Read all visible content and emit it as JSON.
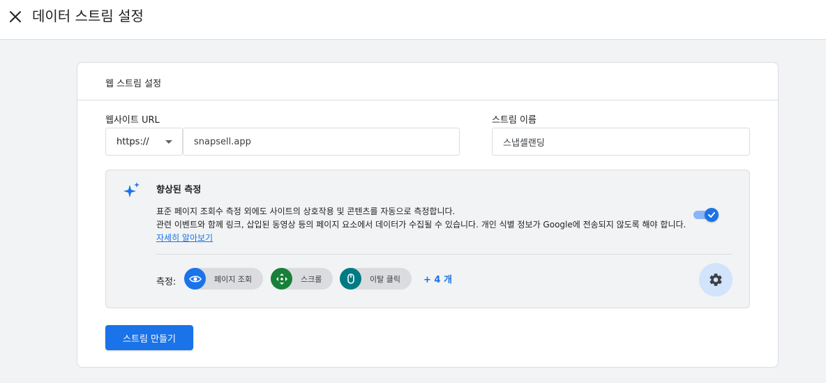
{
  "header": {
    "title": "데이터 스트림 설정",
    "close_icon": "close-icon"
  },
  "card": {
    "title": "웹 스트림 설정"
  },
  "website": {
    "label": "웹사이트 URL",
    "protocol": "https://",
    "url": "snapsell.app"
  },
  "stream_name": {
    "label": "스트림 이름",
    "value": "스냅셀랜딩"
  },
  "enhanced": {
    "icon": "sparkle-icon",
    "title": "향상된 측정",
    "desc_line1": "표준 페이지 조회수 측정 외에도 사이트의 상호작용 및 콘텐츠를 자동으로 측정합니다.",
    "desc_line2": "관련 이벤트와 함께 링크, 삽입된 동영상 등의 페이지 요소에서 데이터가 수집될 수 있습니다. 개인 식별 정보가 Google에 전송되지 않도록 해야 합니다.",
    "learn_more": "자세히 알아보기",
    "enabled": true,
    "metrics_label": "측정:",
    "metrics": [
      {
        "label": "페이지 조회",
        "icon": "eye-icon",
        "color": "#1a73e8"
      },
      {
        "label": "스크롤",
        "icon": "scroll-arrows-icon",
        "color": "#188038"
      },
      {
        "label": "이탈 클릭",
        "icon": "mouse-icon",
        "color": "#007b83"
      }
    ],
    "more": "+ 4 개",
    "settings_icon": "gear-icon"
  },
  "actions": {
    "create_label": "스트림 만들기"
  },
  "colors": {
    "primary": "#1a73e8",
    "page_bg": "#f1f3f4"
  }
}
